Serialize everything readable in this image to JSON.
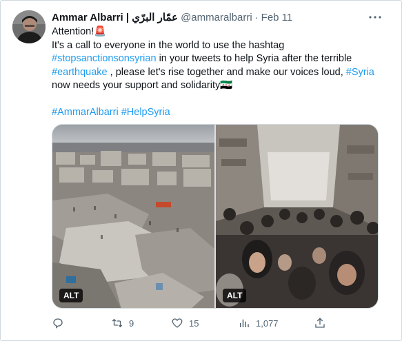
{
  "tweet": {
    "author_name": "Ammar Albarri | عمّار البرّي",
    "handle": "@ammaralbarri",
    "separator": "·",
    "date": "Feb 11",
    "body": {
      "line1_text": "Attention!",
      "line1_emoji": "🚨",
      "line2": "It's a call to everyone in the world to use the hashtag",
      "line3_hashtag": "#stopsanctionsonsyrian",
      "line3_rest": " in your tweets to help Syria after the terrible",
      "line4_hashtag": "#earthquake",
      "line4_middle": " , please let's rise together and make our voices loud, ",
      "line4_hashtag2": "#Syria",
      "line5_text": "now needs your support and solidarity",
      "line5_emoji": "🇸🇾",
      "tags": [
        "#AmmarAlbarri",
        "#HelpSyria"
      ]
    },
    "media": [
      {
        "alt_badge": "ALT",
        "depicts": "earthquake-rubble-aerial"
      },
      {
        "alt_badge": "ALT",
        "depicts": "crowd-in-destroyed-street"
      }
    ],
    "actions": {
      "replies": "",
      "retweets": "9",
      "likes": "15",
      "views": "1,077"
    },
    "icons": {
      "more": "more-options-icon",
      "reply": "reply-icon",
      "retweet": "retweet-icon",
      "like": "like-icon",
      "views": "views-icon",
      "share": "share-icon"
    },
    "colors": {
      "link": "#1d9bf0",
      "text": "#0f1419",
      "secondary": "#536471",
      "border": "#cfd9de"
    }
  }
}
